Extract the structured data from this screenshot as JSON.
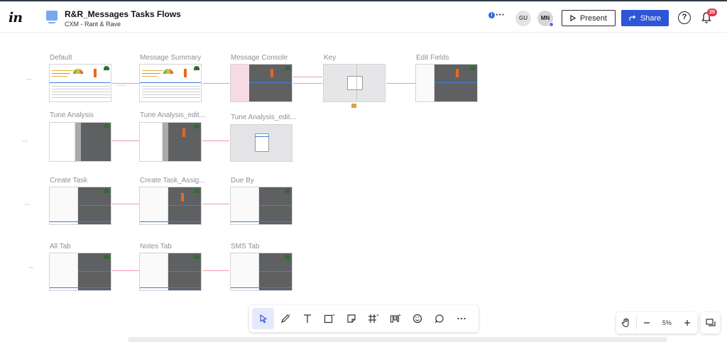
{
  "header": {
    "logo": "in",
    "doc_title": "R&R_Messages Tasks Flows",
    "doc_subtitle": "CXM - Rant & Rave",
    "info_icon": "info-icon",
    "avatars": [
      {
        "initials": "GU"
      },
      {
        "initials": "MN"
      }
    ],
    "present_label": "Present",
    "share_label": "Share",
    "notifications_count": "25"
  },
  "frames": [
    {
      "label": "Default"
    },
    {
      "label": "Message Summary"
    },
    {
      "label": "Message Console"
    },
    {
      "label": "Key"
    },
    {
      "label": "Edit Fields"
    },
    {
      "label": "Tune Analysis"
    },
    {
      "label": "Tune Analysis_edit..."
    },
    {
      "label": "Tune Analysis_edit..."
    },
    {
      "label": "Create Task"
    },
    {
      "label": "Create Task_Assig..."
    },
    {
      "label": "Due By"
    },
    {
      "label": "All Tab"
    },
    {
      "label": "Notes Tab"
    },
    {
      "label": "SMS Tab"
    }
  ],
  "toolbar": {
    "tools": [
      "select-arrow-icon",
      "pen-icon",
      "text-icon",
      "shape-icon",
      "sticky-note-icon",
      "frame-icon",
      "board-icon",
      "palette-icon",
      "comment-icon",
      "more-icon"
    ]
  },
  "zoom": {
    "value": "5%"
  },
  "colors": {
    "accent": "#2d55d6",
    "badge": "#e8344e",
    "connector": "#f29aab"
  }
}
